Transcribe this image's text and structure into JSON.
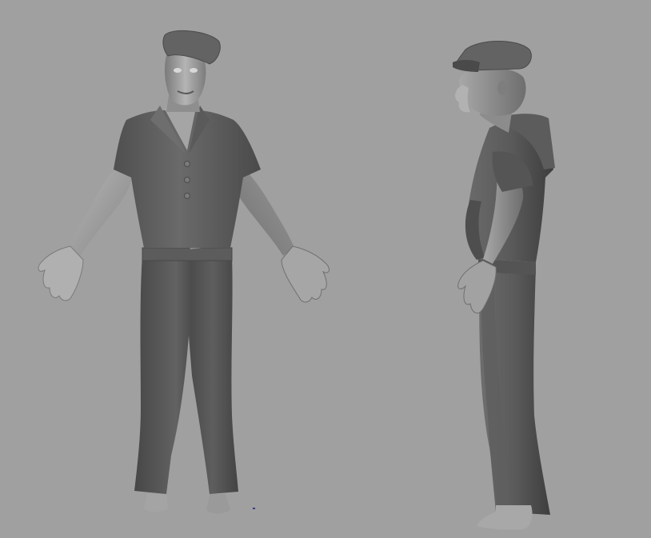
{
  "viewport": {
    "background": "#a0a0a0",
    "models": [
      {
        "view": "front",
        "subject": "sailor-character-sculpt"
      },
      {
        "view": "side",
        "subject": "sailor-character-sculpt"
      }
    ],
    "colors": {
      "shirt": "#5e5e5e",
      "skin": "#9a9a9a",
      "pants": "#575757",
      "cap": "#606060"
    }
  }
}
